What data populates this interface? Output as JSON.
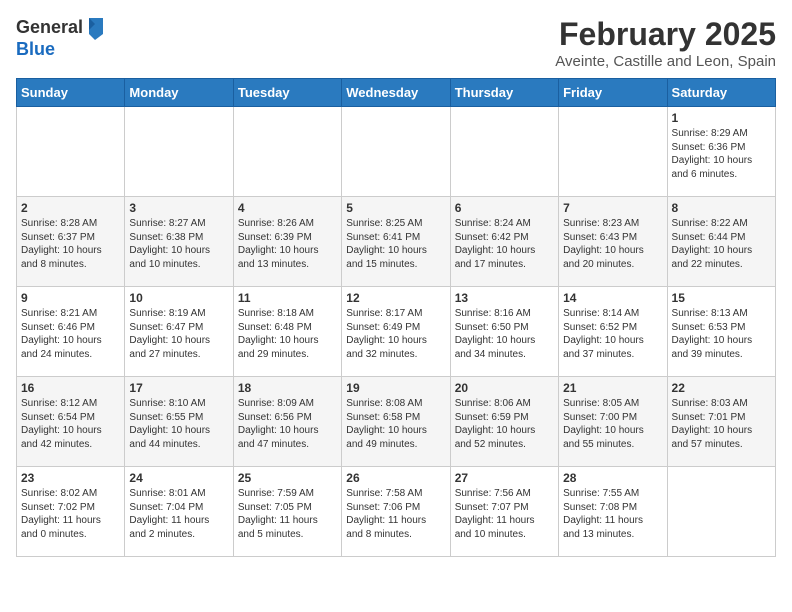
{
  "logo": {
    "general": "General",
    "blue": "Blue"
  },
  "title": "February 2025",
  "subtitle": "Aveinte, Castille and Leon, Spain",
  "weekdays": [
    "Sunday",
    "Monday",
    "Tuesday",
    "Wednesday",
    "Thursday",
    "Friday",
    "Saturday"
  ],
  "weeks": [
    [
      {
        "day": "",
        "info": ""
      },
      {
        "day": "",
        "info": ""
      },
      {
        "day": "",
        "info": ""
      },
      {
        "day": "",
        "info": ""
      },
      {
        "day": "",
        "info": ""
      },
      {
        "day": "",
        "info": ""
      },
      {
        "day": "1",
        "info": "Sunrise: 8:29 AM\nSunset: 6:36 PM\nDaylight: 10 hours\nand 6 minutes."
      }
    ],
    [
      {
        "day": "2",
        "info": "Sunrise: 8:28 AM\nSunset: 6:37 PM\nDaylight: 10 hours\nand 8 minutes."
      },
      {
        "day": "3",
        "info": "Sunrise: 8:27 AM\nSunset: 6:38 PM\nDaylight: 10 hours\nand 10 minutes."
      },
      {
        "day": "4",
        "info": "Sunrise: 8:26 AM\nSunset: 6:39 PM\nDaylight: 10 hours\nand 13 minutes."
      },
      {
        "day": "5",
        "info": "Sunrise: 8:25 AM\nSunset: 6:41 PM\nDaylight: 10 hours\nand 15 minutes."
      },
      {
        "day": "6",
        "info": "Sunrise: 8:24 AM\nSunset: 6:42 PM\nDaylight: 10 hours\nand 17 minutes."
      },
      {
        "day": "7",
        "info": "Sunrise: 8:23 AM\nSunset: 6:43 PM\nDaylight: 10 hours\nand 20 minutes."
      },
      {
        "day": "8",
        "info": "Sunrise: 8:22 AM\nSunset: 6:44 PM\nDaylight: 10 hours\nand 22 minutes."
      }
    ],
    [
      {
        "day": "9",
        "info": "Sunrise: 8:21 AM\nSunset: 6:46 PM\nDaylight: 10 hours\nand 24 minutes."
      },
      {
        "day": "10",
        "info": "Sunrise: 8:19 AM\nSunset: 6:47 PM\nDaylight: 10 hours\nand 27 minutes."
      },
      {
        "day": "11",
        "info": "Sunrise: 8:18 AM\nSunset: 6:48 PM\nDaylight: 10 hours\nand 29 minutes."
      },
      {
        "day": "12",
        "info": "Sunrise: 8:17 AM\nSunset: 6:49 PM\nDaylight: 10 hours\nand 32 minutes."
      },
      {
        "day": "13",
        "info": "Sunrise: 8:16 AM\nSunset: 6:50 PM\nDaylight: 10 hours\nand 34 minutes."
      },
      {
        "day": "14",
        "info": "Sunrise: 8:14 AM\nSunset: 6:52 PM\nDaylight: 10 hours\nand 37 minutes."
      },
      {
        "day": "15",
        "info": "Sunrise: 8:13 AM\nSunset: 6:53 PM\nDaylight: 10 hours\nand 39 minutes."
      }
    ],
    [
      {
        "day": "16",
        "info": "Sunrise: 8:12 AM\nSunset: 6:54 PM\nDaylight: 10 hours\nand 42 minutes."
      },
      {
        "day": "17",
        "info": "Sunrise: 8:10 AM\nSunset: 6:55 PM\nDaylight: 10 hours\nand 44 minutes."
      },
      {
        "day": "18",
        "info": "Sunrise: 8:09 AM\nSunset: 6:56 PM\nDaylight: 10 hours\nand 47 minutes."
      },
      {
        "day": "19",
        "info": "Sunrise: 8:08 AM\nSunset: 6:58 PM\nDaylight: 10 hours\nand 49 minutes."
      },
      {
        "day": "20",
        "info": "Sunrise: 8:06 AM\nSunset: 6:59 PM\nDaylight: 10 hours\nand 52 minutes."
      },
      {
        "day": "21",
        "info": "Sunrise: 8:05 AM\nSunset: 7:00 PM\nDaylight: 10 hours\nand 55 minutes."
      },
      {
        "day": "22",
        "info": "Sunrise: 8:03 AM\nSunset: 7:01 PM\nDaylight: 10 hours\nand 57 minutes."
      }
    ],
    [
      {
        "day": "23",
        "info": "Sunrise: 8:02 AM\nSunset: 7:02 PM\nDaylight: 11 hours\nand 0 minutes."
      },
      {
        "day": "24",
        "info": "Sunrise: 8:01 AM\nSunset: 7:04 PM\nDaylight: 11 hours\nand 2 minutes."
      },
      {
        "day": "25",
        "info": "Sunrise: 7:59 AM\nSunset: 7:05 PM\nDaylight: 11 hours\nand 5 minutes."
      },
      {
        "day": "26",
        "info": "Sunrise: 7:58 AM\nSunset: 7:06 PM\nDaylight: 11 hours\nand 8 minutes."
      },
      {
        "day": "27",
        "info": "Sunrise: 7:56 AM\nSunset: 7:07 PM\nDaylight: 11 hours\nand 10 minutes."
      },
      {
        "day": "28",
        "info": "Sunrise: 7:55 AM\nSunset: 7:08 PM\nDaylight: 11 hours\nand 13 minutes."
      },
      {
        "day": "",
        "info": ""
      }
    ]
  ]
}
